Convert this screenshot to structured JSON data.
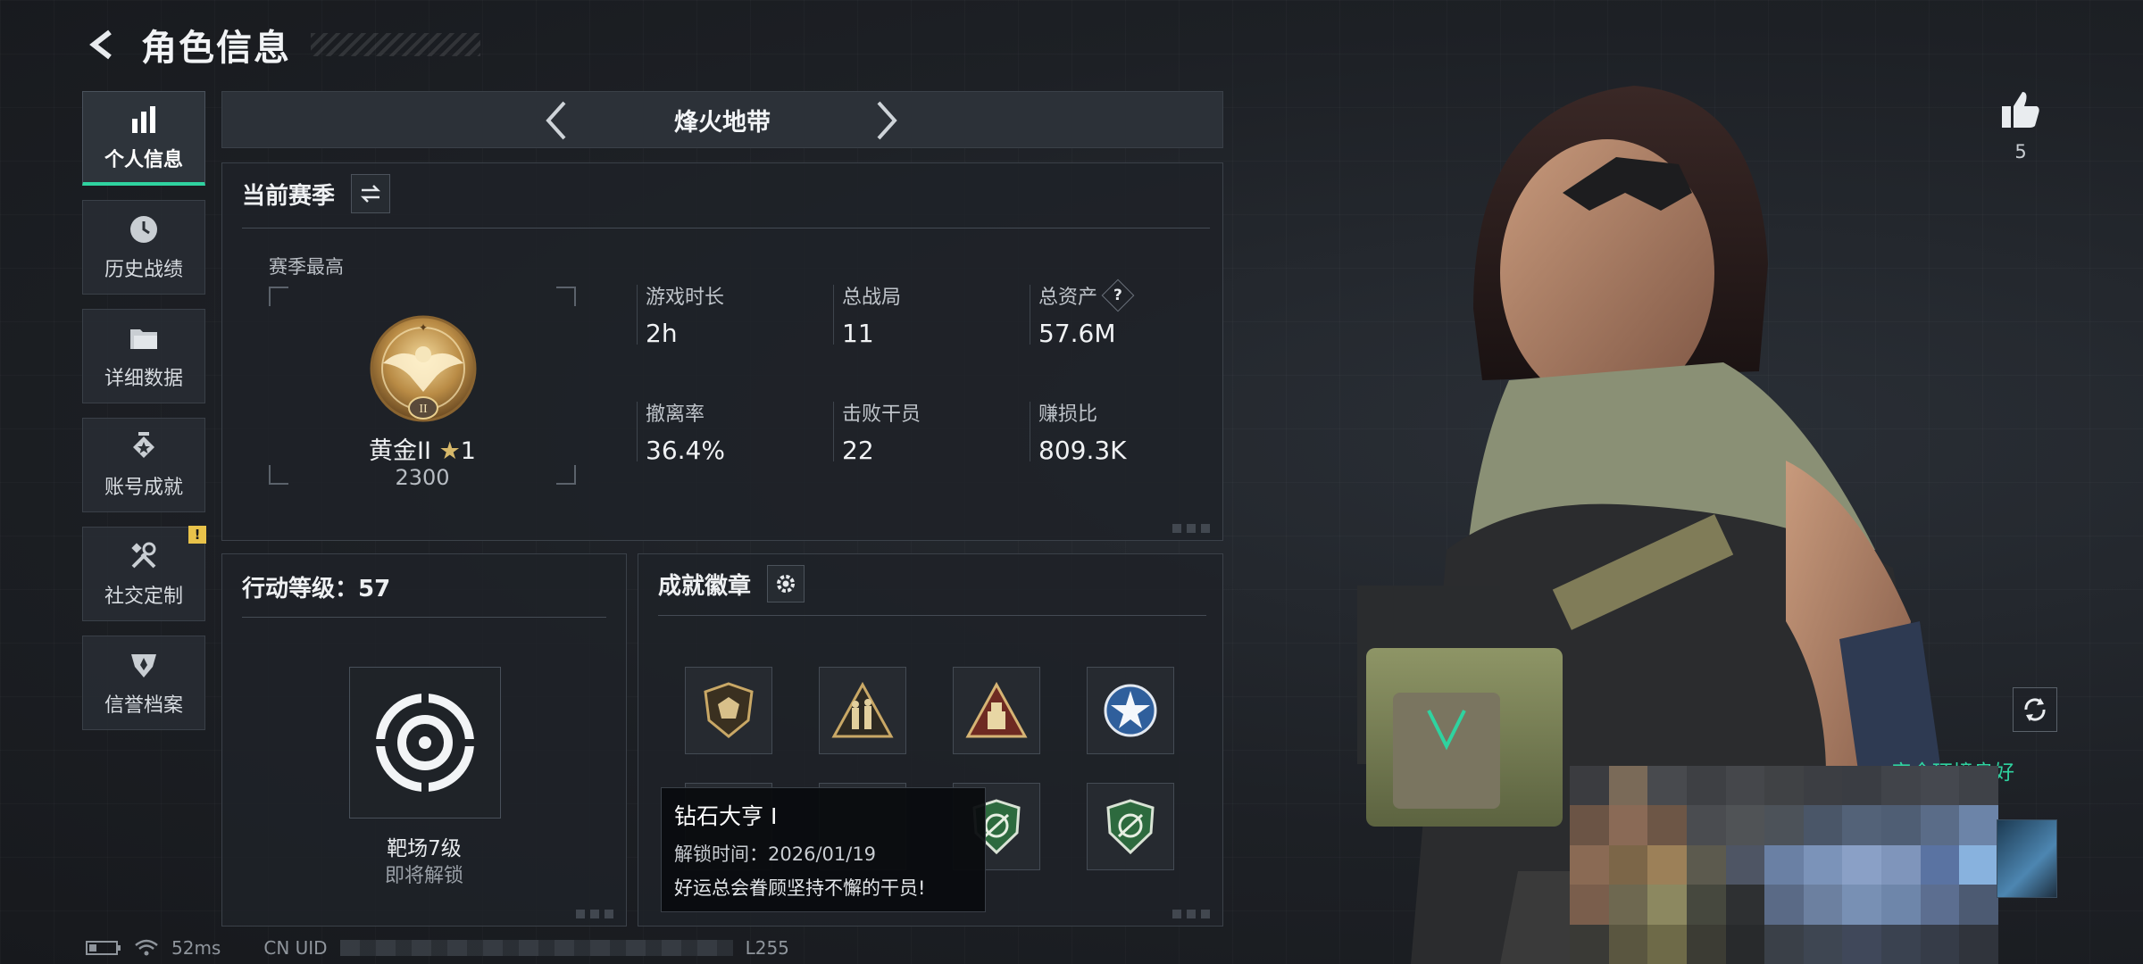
{
  "header": {
    "title": "角色信息"
  },
  "sidebar": {
    "items": [
      {
        "label": "个人信息",
        "icon": "bar-chart-icon",
        "active": true
      },
      {
        "label": "历史战绩",
        "icon": "clock-history-icon",
        "active": false
      },
      {
        "label": "详细数据",
        "icon": "folder-icon",
        "active": false
      },
      {
        "label": "账号成就",
        "icon": "achievement-star-icon",
        "active": false
      },
      {
        "label": "社交定制",
        "icon": "wrench-tools-icon",
        "active": false,
        "alert": "!"
      },
      {
        "label": "信誉档案",
        "icon": "shield-emblem-icon",
        "active": false
      }
    ]
  },
  "mode": {
    "name": "烽火地带"
  },
  "season": {
    "title": "当前赛季",
    "best_label": "赛季最高",
    "rank_name": "黄金II",
    "rank_stars": "1",
    "rank_score": "2300",
    "stats": [
      {
        "label": "游戏时长",
        "value": "2h"
      },
      {
        "label": "总战局",
        "value": "11"
      },
      {
        "label": "总资产",
        "value": "57.6M",
        "help": "?"
      },
      {
        "label": "撤离率",
        "value": "36.4%"
      },
      {
        "label": "击败干员",
        "value": "22"
      },
      {
        "label": "赚损比",
        "value": "809.3K"
      }
    ]
  },
  "level": {
    "title": "行动等级：57",
    "range_name": "靶场7级",
    "range_status": "即将解锁"
  },
  "badges": {
    "title": "成就徽章",
    "items": [
      "d20-shield-badge",
      "soldiers-triangle-badge",
      "supply-triangle-badge",
      "blue-star-badge",
      "hidden-badge",
      "hidden-badge",
      "green-shield-badge",
      "green-shield-badge"
    ]
  },
  "tooltip": {
    "title": "钻石大亨 I",
    "unlock_line": "解锁时间：2026/01/19",
    "desc": "好运总会眷顾坚持不懈的干员!"
  },
  "status_bar": {
    "ping": "52ms",
    "uid_prefix": "CN UID",
    "uid_suffix": "L255"
  },
  "right": {
    "like_count": "5",
    "env_status": "安全环境良好"
  },
  "colors": {
    "accent": "#2fd3a0",
    "gold": "#d6b86a",
    "panel": "#1e2228"
  }
}
